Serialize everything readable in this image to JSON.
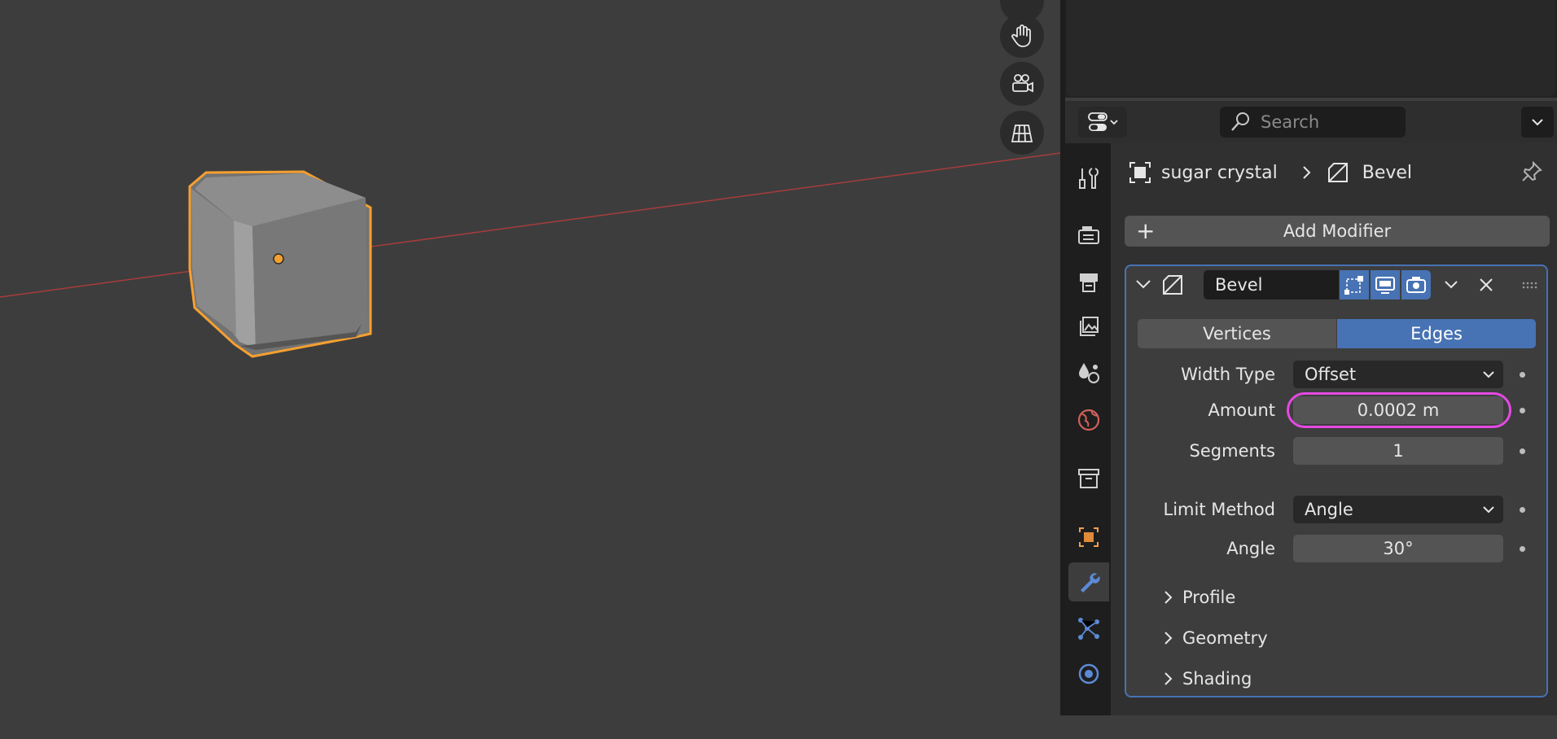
{
  "viewport": {
    "object_name": "sugar crystal",
    "icons": [
      "hand-pan-icon",
      "camera-view-icon",
      "grid-ortho-icon"
    ]
  },
  "header": {
    "search_placeholder": "Search"
  },
  "breadcrumb": {
    "object": "sugar crystal",
    "modifier": "Bevel"
  },
  "add_modifier_label": "Add Modifier",
  "modifier": {
    "name": "Bevel",
    "affect": {
      "options": [
        "Vertices",
        "Edges"
      ],
      "selected": "Edges"
    },
    "width_type": {
      "label": "Width Type",
      "value": "Offset"
    },
    "amount": {
      "label": "Amount",
      "value": "0.0002 m"
    },
    "segments": {
      "label": "Segments",
      "value": "1"
    },
    "limit_method": {
      "label": "Limit Method",
      "value": "Angle"
    },
    "angle": {
      "label": "Angle",
      "value": "30°"
    },
    "subpanels": [
      "Profile",
      "Geometry",
      "Shading"
    ]
  },
  "colors": {
    "accent": "#4772b3",
    "selection_outline": "#f5a030",
    "highlight_ring": "#e549e3",
    "x_axis": "#a83c3c"
  }
}
